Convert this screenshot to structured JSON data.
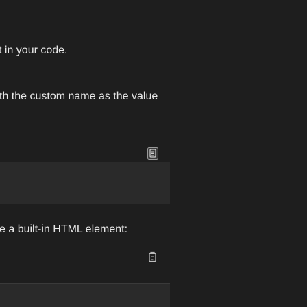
{
  "content": {
    "paragraph_1": "t in your code.",
    "paragraph_2": "th the custom name as the value",
    "paragraph_3": "e a built-in HTML element:"
  },
  "icons": {
    "copy_1": "copy-icon",
    "copy_2": "copy-icon"
  },
  "colors": {
    "background": "#1e1e1e",
    "code_block": "#2a2a2a",
    "text": "#e8e8e8",
    "icon": "#b8b8b8",
    "icon_active_bg": "#3b3b3b"
  }
}
